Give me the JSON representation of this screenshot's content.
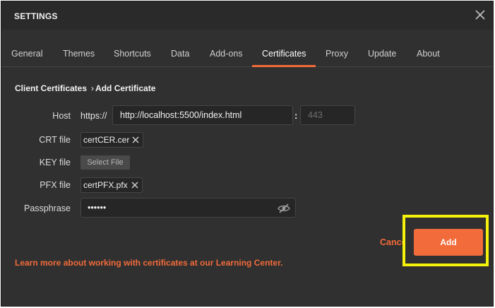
{
  "title": "SETTINGS",
  "tabs": [
    {
      "label": "General"
    },
    {
      "label": "Themes"
    },
    {
      "label": "Shortcuts"
    },
    {
      "label": "Data"
    },
    {
      "label": "Add-ons"
    },
    {
      "label": "Certificates"
    },
    {
      "label": "Proxy"
    },
    {
      "label": "Update"
    },
    {
      "label": "About"
    }
  ],
  "active_tab": "Certificates",
  "breadcrumb": {
    "parent": "Client Certificates",
    "separator": "›",
    "current": "Add Certificate"
  },
  "form": {
    "host_label": "Host",
    "host_prefix": "https://",
    "host_value": "http://localhost:5500/index.html",
    "host_separator": ":",
    "port_placeholder": "443",
    "crt_label": "CRT file",
    "crt_value": "certCER.cer",
    "key_label": "KEY file",
    "key_button": "Select File",
    "pfx_label": "PFX file",
    "pfx_value": "certPFX.pfx",
    "passphrase_label": "Passphrase",
    "passphrase_value": "••••••"
  },
  "actions": {
    "cancel_label": "Cancel",
    "add_label": "Add"
  },
  "learn_more_text": "Learn more about working with certificates at our Learning Center.",
  "colors": {
    "accent": "#f26b3a",
    "highlight": "#f4f10a",
    "background": "#303030"
  },
  "icons": {
    "close": "close-icon",
    "chip_remove": "close-icon",
    "visibility": "eye-off-icon"
  }
}
